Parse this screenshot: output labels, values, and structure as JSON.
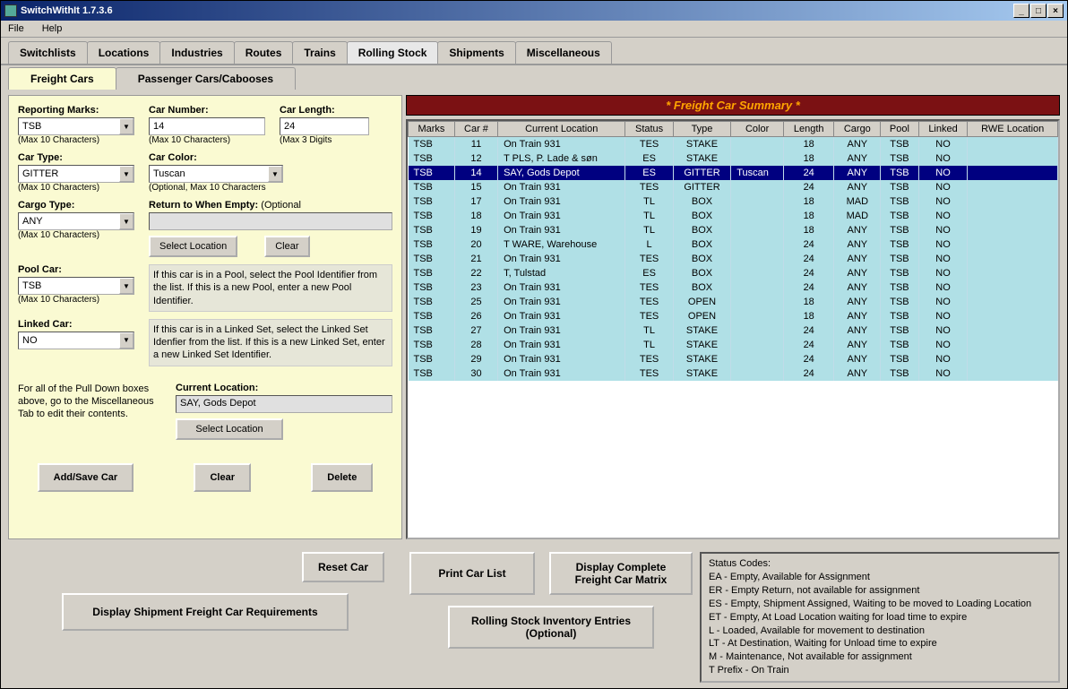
{
  "window": {
    "title": "SwitchWithIt 1.7.3.6"
  },
  "menu": {
    "file": "File",
    "help": "Help"
  },
  "tabs": [
    "Switchlists",
    "Locations",
    "Industries",
    "Routes",
    "Trains",
    "Rolling Stock",
    "Shipments",
    "Miscellaneous"
  ],
  "active_tab": "Rolling Stock",
  "sub_tabs": [
    "Freight Cars",
    "Passenger Cars/Cabooses"
  ],
  "active_sub_tab": "Freight Cars",
  "form": {
    "reporting_marks": {
      "label": "Reporting Marks:",
      "value": "TSB",
      "hint": "(Max 10 Characters)"
    },
    "car_number": {
      "label": "Car Number:",
      "value": "14",
      "hint": "(Max 10 Characters)"
    },
    "car_length": {
      "label": "Car Length:",
      "value": "24",
      "hint": "(Max 3 Digits"
    },
    "car_type": {
      "label": "Car Type:",
      "value": "GITTER",
      "hint": "(Max 10 Characters)"
    },
    "car_color": {
      "label": "Car Color:",
      "value": "Tuscan",
      "hint": "(Optional, Max 10 Characters"
    },
    "cargo_type": {
      "label": "Cargo Type:",
      "value": "ANY",
      "hint": "(Max 10 Characters)"
    },
    "return_empty": {
      "label": "Return to When Empty:",
      "optional": "(Optional",
      "value": ""
    },
    "pool_car": {
      "label": "Pool Car:",
      "value": "TSB",
      "hint": "(Max 10 Characters)",
      "help": "If this car is in a Pool, select the Pool Identifier from the list.  If this is a new Pool, enter a new Pool Identifier."
    },
    "linked_car": {
      "label": "Linked Car:",
      "value": "NO",
      "help": "If this car is in a Linked Set, select the Linked Set Idenfier from the list.  If this is a new Linked Set, enter a new Linked Set Identifier."
    },
    "current_location": {
      "label": "Current Location:",
      "value": "SAY, Gods Depot"
    },
    "pulldown_note": "For all of the Pull Down boxes above, go to the Miscellaneous Tab to edit their contents."
  },
  "buttons": {
    "select_location": "Select Location",
    "clear": "Clear",
    "add_save": "Add/Save Car",
    "delete": "Delete",
    "reset_car": "Reset Car",
    "print_car_list": "Print Car List",
    "display_matrix": "Display Complete Freight Car Matrix",
    "display_req": "Display Shipment Freight Car Requirements",
    "inventory": "Rolling Stock Inventory Entries (Optional)"
  },
  "summary": {
    "title": "* Freight Car Summary *",
    "headers": [
      "Marks",
      "Car #",
      "Current Location",
      "Status",
      "Type",
      "Color",
      "Length",
      "Cargo",
      "Pool",
      "Linked",
      "RWE Location"
    ],
    "rows": [
      {
        "marks": "TSB",
        "car": "11",
        "loc": "On Train 931",
        "status": "TES",
        "type": "STAKE",
        "color": "",
        "len": "18",
        "cargo": "ANY",
        "pool": "TSB",
        "linked": "NO",
        "rwe": "",
        "sel": false
      },
      {
        "marks": "TSB",
        "car": "12",
        "loc": "T PLS, P. Lade & søn",
        "status": "ES",
        "type": "STAKE",
        "color": "",
        "len": "18",
        "cargo": "ANY",
        "pool": "TSB",
        "linked": "NO",
        "rwe": "",
        "sel": false
      },
      {
        "marks": "TSB",
        "car": "14",
        "loc": "SAY, Gods Depot",
        "status": "ES",
        "type": "GITTER",
        "color": "Tuscan",
        "len": "24",
        "cargo": "ANY",
        "pool": "TSB",
        "linked": "NO",
        "rwe": "",
        "sel": true
      },
      {
        "marks": "TSB",
        "car": "15",
        "loc": "On Train 931",
        "status": "TES",
        "type": "GITTER",
        "color": "",
        "len": "24",
        "cargo": "ANY",
        "pool": "TSB",
        "linked": "NO",
        "rwe": "",
        "sel": false
      },
      {
        "marks": "TSB",
        "car": "17",
        "loc": "On Train 931",
        "status": "TL",
        "type": "BOX",
        "color": "",
        "len": "18",
        "cargo": "MAD",
        "pool": "TSB",
        "linked": "NO",
        "rwe": "",
        "sel": false
      },
      {
        "marks": "TSB",
        "car": "18",
        "loc": "On Train 931",
        "status": "TL",
        "type": "BOX",
        "color": "",
        "len": "18",
        "cargo": "MAD",
        "pool": "TSB",
        "linked": "NO",
        "rwe": "",
        "sel": false
      },
      {
        "marks": "TSB",
        "car": "19",
        "loc": "On Train 931",
        "status": "TL",
        "type": "BOX",
        "color": "",
        "len": "18",
        "cargo": "ANY",
        "pool": "TSB",
        "linked": "NO",
        "rwe": "",
        "sel": false
      },
      {
        "marks": "TSB",
        "car": "20",
        "loc": "T WARE, Warehouse",
        "status": "L",
        "type": "BOX",
        "color": "",
        "len": "24",
        "cargo": "ANY",
        "pool": "TSB",
        "linked": "NO",
        "rwe": "",
        "sel": false
      },
      {
        "marks": "TSB",
        "car": "21",
        "loc": "On Train 931",
        "status": "TES",
        "type": "BOX",
        "color": "",
        "len": "24",
        "cargo": "ANY",
        "pool": "TSB",
        "linked": "NO",
        "rwe": "",
        "sel": false
      },
      {
        "marks": "TSB",
        "car": "22",
        "loc": "T, Tulstad",
        "status": "ES",
        "type": "BOX",
        "color": "",
        "len": "24",
        "cargo": "ANY",
        "pool": "TSB",
        "linked": "NO",
        "rwe": "",
        "sel": false
      },
      {
        "marks": "TSB",
        "car": "23",
        "loc": "On Train 931",
        "status": "TES",
        "type": "BOX",
        "color": "",
        "len": "24",
        "cargo": "ANY",
        "pool": "TSB",
        "linked": "NO",
        "rwe": "",
        "sel": false
      },
      {
        "marks": "TSB",
        "car": "25",
        "loc": "On Train 931",
        "status": "TES",
        "type": "OPEN",
        "color": "",
        "len": "18",
        "cargo": "ANY",
        "pool": "TSB",
        "linked": "NO",
        "rwe": "",
        "sel": false
      },
      {
        "marks": "TSB",
        "car": "26",
        "loc": "On Train 931",
        "status": "TES",
        "type": "OPEN",
        "color": "",
        "len": "18",
        "cargo": "ANY",
        "pool": "TSB",
        "linked": "NO",
        "rwe": "",
        "sel": false
      },
      {
        "marks": "TSB",
        "car": "27",
        "loc": "On Train 931",
        "status": "TL",
        "type": "STAKE",
        "color": "",
        "len": "24",
        "cargo": "ANY",
        "pool": "TSB",
        "linked": "NO",
        "rwe": "",
        "sel": false
      },
      {
        "marks": "TSB",
        "car": "28",
        "loc": "On Train 931",
        "status": "TL",
        "type": "STAKE",
        "color": "",
        "len": "24",
        "cargo": "ANY",
        "pool": "TSB",
        "linked": "NO",
        "rwe": "",
        "sel": false
      },
      {
        "marks": "TSB",
        "car": "29",
        "loc": "On Train 931",
        "status": "TES",
        "type": "STAKE",
        "color": "",
        "len": "24",
        "cargo": "ANY",
        "pool": "TSB",
        "linked": "NO",
        "rwe": "",
        "sel": false
      },
      {
        "marks": "TSB",
        "car": "30",
        "loc": "On Train 931",
        "status": "TES",
        "type": "STAKE",
        "color": "",
        "len": "24",
        "cargo": "ANY",
        "pool": "TSB",
        "linked": "NO",
        "rwe": "",
        "sel": false
      }
    ]
  },
  "status_codes": {
    "title": "Status Codes:",
    "lines": [
      "EA - Empty, Available for Assignment",
      "ER - Empty Return, not available for assignment",
      "ES - Empty, Shipment Assigned, Waiting to be moved to Loading Location",
      "ET - Empty, At Load Location waiting for load time to expire",
      "L - Loaded, Available for movement to destination",
      "LT - At Destination, Waiting for Unload time to expire",
      "M - Maintenance, Not available for assignment",
      "T Prefix - On Train"
    ]
  }
}
